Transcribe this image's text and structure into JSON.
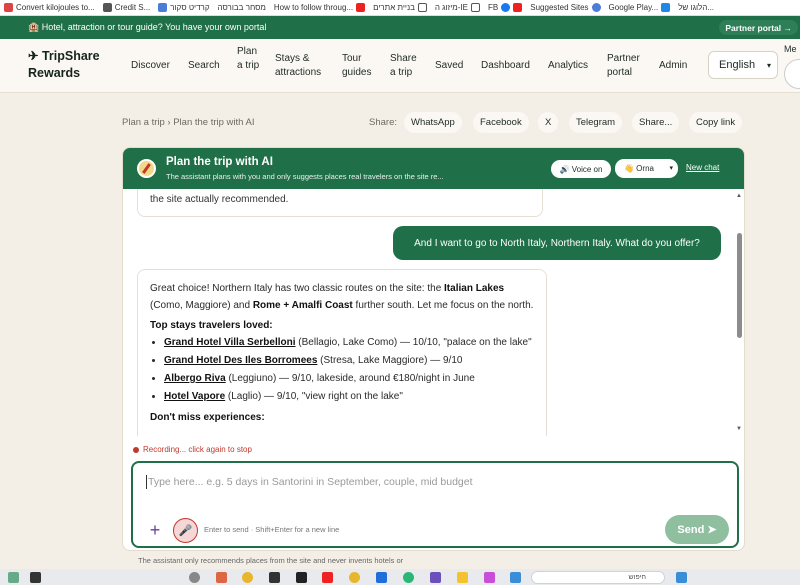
{
  "bookmarks": [
    "Convert kilojoules to...",
    "Credit S...",
    "קרדיט סקור",
    "מסחר בבורסה",
    "How to follow throug...",
    "בניית אתרים",
    "מיזוג ה-IE",
    "FB",
    "Suggested Sites",
    "Google Play...",
    "הלוגו של..."
  ],
  "promo": {
    "text": "🏨 Hotel, attraction or tour guide? You have your own portal",
    "portal_button": "Partner portal →"
  },
  "nav": {
    "logo": "✈ TripShare Rewards",
    "items": [
      "Discover",
      "Search",
      "Plan a trip",
      "Stays & attractions",
      "Tour guides",
      "Share a trip",
      "Saved",
      "Dashboard",
      "Analytics",
      "Partner portal",
      "Admin"
    ],
    "language": "English",
    "me_label": "Me"
  },
  "breadcrumb": "Plan a trip › Plan the trip with AI",
  "share": {
    "label": "Share:",
    "buttons": [
      "WhatsApp",
      "Facebook",
      "X",
      "Telegram",
      "Share...",
      "Copy link"
    ]
  },
  "chat": {
    "title": "Plan the trip with AI",
    "subtitle": "The assistant plans with you and only suggests places real travelers on the site re...",
    "voice_label": "🔊 Voice on",
    "persona_label": "👋 Orna",
    "new_chat": "New chat",
    "prev_message_tail": "the site actually recommended.",
    "user_message": "And I want to go to North Italy, Northern Italy. What do you offer?",
    "ai_intro_1": "Great choice! Northern Italy has two classic routes on the site: the ",
    "ai_intro_bold1": "Italian Lakes",
    "ai_intro_2": " (Como, Maggiore) and ",
    "ai_intro_bold2": "Rome + Amalfi Coast",
    "ai_intro_3": " further south. Let me focus on the north.",
    "stays_heading": "Top stays travelers loved:",
    "stays": [
      {
        "name": "Grand Hotel Villa Serbelloni",
        "detail": " (Bellagio, Lake Como) — 10/10, \"palace on the lake\""
      },
      {
        "name": "Grand Hotel Des Iles Borromees",
        "detail": " (Stresa, Lake Maggiore) — 9/10"
      },
      {
        "name": "Albergo Riva",
        "detail": " (Leggiuno) — 9/10, lakeside, around €180/night in June"
      },
      {
        "name": "Hotel Vapore",
        "detail": " (Laglio) — 9/10, \"view right on the lake\""
      }
    ],
    "experiences_heading": "Don't miss experiences:",
    "recording": "Recording... click again to stop",
    "input_placeholder": "Type here... e.g. 5 days in Santorini in September, couple, mid budget",
    "hint": "Enter to send · Shift+Enter for a new line",
    "send_label": "Send ➤",
    "disclaimer": "The assistant only recommends places from the site and never invents hotels or"
  },
  "taskbar": {
    "search_text": "חיפוש"
  },
  "colors": {
    "brand_green": "#1f6f48",
    "page_bg": "#f4efe6",
    "recording_red": "#c0392b"
  }
}
